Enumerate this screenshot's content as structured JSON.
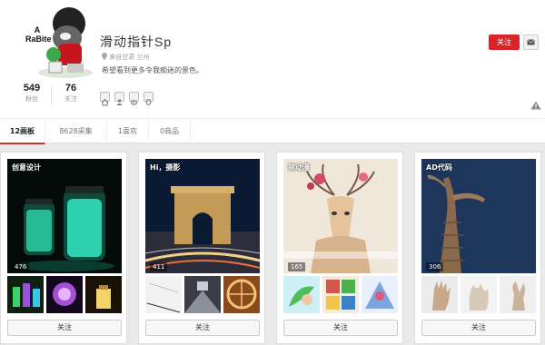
{
  "profile": {
    "avatar_text": "A RaBite",
    "username": "滑动指针Sp",
    "location": "来自甘肃 兰州",
    "bio": "希望看到更多令我痴迷的景色。",
    "stats": [
      {
        "value": "549",
        "label": "粉丝"
      },
      {
        "value": "76",
        "label": "关注"
      }
    ],
    "follow_label": "关注",
    "social_icons": [
      "house-icon",
      "people-icon",
      "weibo-icon",
      "qq-icon"
    ]
  },
  "tabs": [
    {
      "label": "12画板",
      "active": true
    },
    {
      "label": "8628采集",
      "active": false
    },
    {
      "label": "1喜欢",
      "active": false
    },
    {
      "label": "0商品",
      "active": false
    }
  ],
  "boards": [
    {
      "title": "创意设计",
      "count": "476",
      "follow_label": "关注"
    },
    {
      "title": "Hi，摄影",
      "count": "411",
      "follow_label": "关注"
    },
    {
      "title": "萌动漫",
      "count": "165",
      "follow_label": "关注"
    },
    {
      "title": "AD代码",
      "count": "306",
      "follow_label": "关注"
    }
  ],
  "colors": {
    "accent_red": "#d7262a",
    "background": "#e9e9e9"
  }
}
